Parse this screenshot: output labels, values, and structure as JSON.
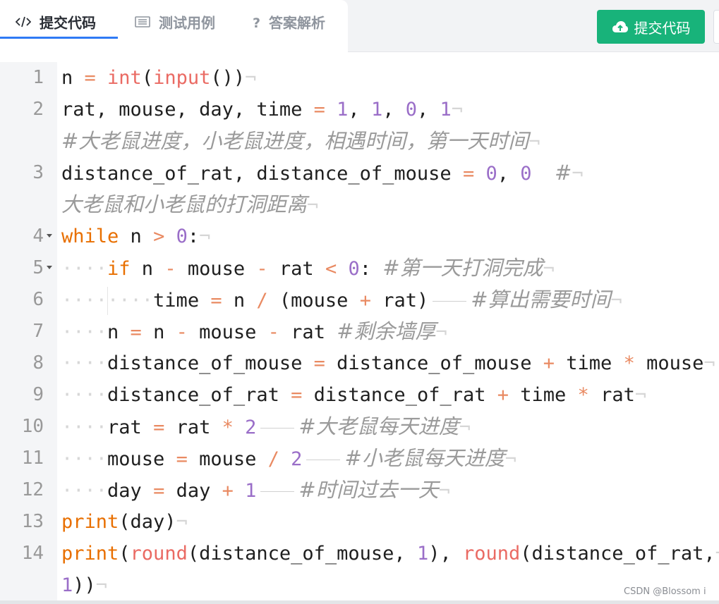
{
  "tabs": [
    {
      "label": "提交代码",
      "icon": "code-icon",
      "active": true
    },
    {
      "label": "测试用例",
      "icon": "list-icon",
      "active": false
    },
    {
      "label": "答案解析",
      "icon": "question-icon",
      "active": false
    }
  ],
  "submit_button": {
    "label": "提交代码",
    "icon": "cloud-upload-icon"
  },
  "colors": {
    "accent": "#2f7af5",
    "submit": "#18b37a",
    "keyword": "#e86f00",
    "builtin": "#ea6a63",
    "number": "#9a6ec8",
    "comment": "#9a9a9a"
  },
  "lines": [
    {
      "n": "1",
      "tokens": [
        [
          "t",
          "n "
        ],
        [
          "o",
          "="
        ],
        [
          "t",
          " "
        ],
        [
          "f",
          "int"
        ],
        [
          "t",
          "("
        ],
        [
          "f",
          "input"
        ],
        [
          "t",
          "())"
        ]
      ]
    },
    {
      "n": "2",
      "tokens": [
        [
          "t",
          "rat, mouse, day, time "
        ],
        [
          "o",
          "="
        ],
        [
          "t",
          " "
        ],
        [
          "num",
          "1"
        ],
        [
          "t",
          ", "
        ],
        [
          "num",
          "1"
        ],
        [
          "t",
          ", "
        ],
        [
          "num",
          "0"
        ],
        [
          "t",
          ", "
        ],
        [
          "num",
          "1"
        ]
      ]
    },
    {
      "n": "",
      "tokens": [
        [
          "c",
          "#大老鼠进度，小老鼠进度，相遇时间，第一天时间"
        ]
      ]
    },
    {
      "n": "3",
      "tokens": [
        [
          "t",
          "distance_of_rat, distance_of_mouse "
        ],
        [
          "o",
          "="
        ],
        [
          "t",
          " "
        ],
        [
          "num",
          "0"
        ],
        [
          "t",
          ", "
        ],
        [
          "num",
          "0"
        ],
        [
          "t",
          "  "
        ],
        [
          "c",
          "#"
        ]
      ]
    },
    {
      "n": "",
      "tokens": [
        [
          "c",
          "大老鼠和小老鼠的打洞距离"
        ]
      ]
    },
    {
      "n": "4",
      "fold": true,
      "tokens": [
        [
          "k",
          "while"
        ],
        [
          "t",
          " n "
        ],
        [
          "o",
          ">"
        ],
        [
          "t",
          " "
        ],
        [
          "num",
          "0"
        ],
        [
          "t",
          ":"
        ]
      ]
    },
    {
      "n": "5",
      "fold": true,
      "tokens": [
        [
          "ws",
          "····"
        ],
        [
          "k",
          "if"
        ],
        [
          "t",
          " n "
        ],
        [
          "o",
          "-"
        ],
        [
          "t",
          " mouse "
        ],
        [
          "o",
          "-"
        ],
        [
          "t",
          " rat "
        ],
        [
          "o",
          "<"
        ],
        [
          "t",
          " "
        ],
        [
          "num",
          "0"
        ],
        [
          "t",
          ": "
        ],
        [
          "c",
          "#第一天打洞完成"
        ]
      ]
    },
    {
      "n": "6",
      "tokens": [
        [
          "ws",
          "········"
        ],
        [
          "t",
          "time "
        ],
        [
          "o",
          "="
        ],
        [
          "t",
          " n "
        ],
        [
          "o",
          "/"
        ],
        [
          "t",
          " (mouse "
        ],
        [
          "o",
          "+"
        ],
        [
          "t",
          " rat)"
        ],
        [
          "tab",
          ""
        ],
        [
          "c",
          "#算出需要时间"
        ]
      ]
    },
    {
      "n": "7",
      "tokens": [
        [
          "ws",
          "····"
        ],
        [
          "t",
          "n "
        ],
        [
          "o",
          "="
        ],
        [
          "t",
          " n "
        ],
        [
          "o",
          "-"
        ],
        [
          "t",
          " mouse "
        ],
        [
          "o",
          "-"
        ],
        [
          "t",
          " rat "
        ],
        [
          "c",
          "#剩余墙厚"
        ]
      ]
    },
    {
      "n": "8",
      "tokens": [
        [
          "ws",
          "····"
        ],
        [
          "t",
          "distance_of_mouse "
        ],
        [
          "o",
          "="
        ],
        [
          "t",
          " distance_of_mouse "
        ],
        [
          "o",
          "+"
        ],
        [
          "t",
          " time "
        ],
        [
          "o",
          "*"
        ],
        [
          "t",
          " mouse"
        ]
      ]
    },
    {
      "n": "9",
      "tokens": [
        [
          "ws",
          "····"
        ],
        [
          "t",
          "distance_of_rat "
        ],
        [
          "o",
          "="
        ],
        [
          "t",
          " distance_of_rat "
        ],
        [
          "o",
          "+"
        ],
        [
          "t",
          " time "
        ],
        [
          "o",
          "*"
        ],
        [
          "t",
          " rat"
        ]
      ]
    },
    {
      "n": "10",
      "tokens": [
        [
          "ws",
          "····"
        ],
        [
          "t",
          "rat "
        ],
        [
          "o",
          "="
        ],
        [
          "t",
          " rat "
        ],
        [
          "o",
          "*"
        ],
        [
          "t",
          " "
        ],
        [
          "num",
          "2"
        ],
        [
          "tab",
          ""
        ],
        [
          "c",
          "#大老鼠每天进度"
        ]
      ]
    },
    {
      "n": "11",
      "tokens": [
        [
          "ws",
          "····"
        ],
        [
          "t",
          "mouse "
        ],
        [
          "o",
          "="
        ],
        [
          "t",
          " mouse "
        ],
        [
          "o",
          "/"
        ],
        [
          "t",
          " "
        ],
        [
          "num",
          "2"
        ],
        [
          "tab",
          ""
        ],
        [
          "c",
          "#小老鼠每天进度"
        ]
      ]
    },
    {
      "n": "12",
      "tokens": [
        [
          "ws",
          "····"
        ],
        [
          "t",
          "day "
        ],
        [
          "o",
          "="
        ],
        [
          "t",
          " day "
        ],
        [
          "o",
          "+"
        ],
        [
          "t",
          " "
        ],
        [
          "num",
          "1"
        ],
        [
          "tab",
          ""
        ],
        [
          "c",
          "#时间过去一天"
        ]
      ]
    },
    {
      "n": "13",
      "tokens": [
        [
          "k",
          "print"
        ],
        [
          "t",
          "(day)"
        ]
      ]
    },
    {
      "n": "14",
      "tokens": [
        [
          "k",
          "print"
        ],
        [
          "t",
          "("
        ],
        [
          "f",
          "round"
        ],
        [
          "t",
          "(distance_of_mouse, "
        ],
        [
          "num",
          "1"
        ],
        [
          "t",
          "), "
        ],
        [
          "f",
          "round"
        ],
        [
          "t",
          "(distance_of_rat,"
        ]
      ]
    },
    {
      "n": "",
      "tokens": [
        [
          "num",
          "1"
        ],
        [
          "t",
          "))"
        ]
      ]
    }
  ],
  "watermark": "CSDN @Blossom i"
}
